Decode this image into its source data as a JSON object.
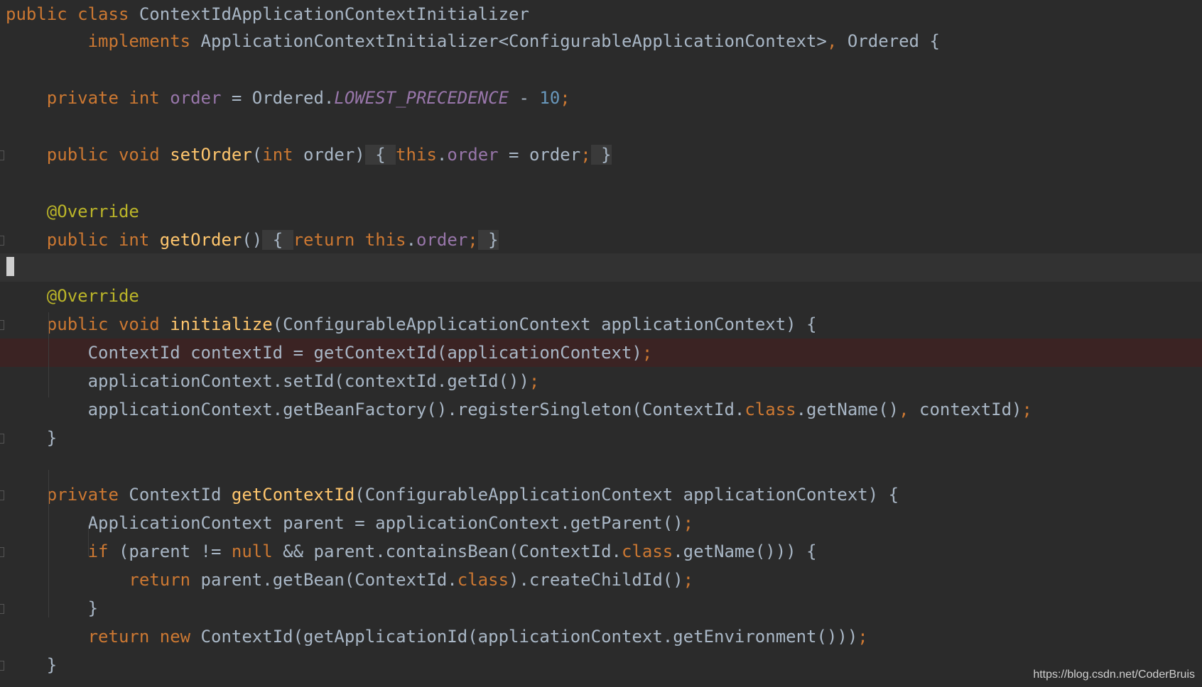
{
  "editor": {
    "theme_colors": {
      "background": "#2b2b2b",
      "keyword": "#cc7832",
      "method_declaration": "#ffc66d",
      "field": "#9876aa",
      "number": "#6897bb",
      "annotation": "#bbb529",
      "plain_text": "#a9b7c6",
      "error_line": "#3b2323",
      "caret_line": "#323232"
    },
    "caret_line": 9,
    "error_line": 12,
    "lines": [
      [
        [
          "kw",
          "public "
        ],
        [
          "kw",
          "class "
        ],
        [
          "plain",
          "ContextIdApplicationContextInitializer"
        ]
      ],
      [
        [
          "plain",
          "        "
        ],
        [
          "kw",
          "implements "
        ],
        [
          "plain",
          "ApplicationContextInitializer<ConfigurableApplicationContext>"
        ],
        [
          "kw",
          ", "
        ],
        [
          "plain",
          "Ordered {"
        ]
      ],
      [],
      [
        [
          "plain",
          "    "
        ],
        [
          "kw",
          "private "
        ],
        [
          "kw",
          "int "
        ],
        [
          "fld",
          "order"
        ],
        [
          "plain",
          " = Ordered."
        ],
        [
          "static",
          "LOWEST_PRECEDENCE"
        ],
        [
          "plain",
          " - "
        ],
        [
          "num",
          "10"
        ],
        [
          "kw",
          ";"
        ]
      ],
      [],
      [
        [
          "plain",
          "    "
        ],
        [
          "kw",
          "public "
        ],
        [
          "kw",
          "void "
        ],
        [
          "fn",
          "setOrder"
        ],
        [
          "plain",
          "("
        ],
        [
          "kw",
          "int "
        ],
        [
          "plain",
          "order)"
        ],
        [
          "fold",
          " { "
        ],
        [
          "kw",
          "this"
        ],
        [
          "plain",
          "."
        ],
        [
          "fld",
          "order"
        ],
        [
          "plain",
          " = order"
        ],
        [
          "kw",
          ";"
        ],
        [
          "fold",
          " }"
        ]
      ],
      [],
      [
        [
          "plain",
          "    "
        ],
        [
          "ann",
          "@Override"
        ]
      ],
      [
        [
          "plain",
          "    "
        ],
        [
          "kw",
          "public "
        ],
        [
          "kw",
          "int "
        ],
        [
          "fn",
          "getOrder"
        ],
        [
          "plain",
          "()"
        ],
        [
          "fold",
          " { "
        ],
        [
          "kw",
          "return "
        ],
        [
          "kw",
          "this"
        ],
        [
          "plain",
          "."
        ],
        [
          "fld",
          "order"
        ],
        [
          "kw",
          ";"
        ],
        [
          "fold",
          " }"
        ]
      ],
      [],
      [
        [
          "plain",
          "    "
        ],
        [
          "ann",
          "@Override"
        ]
      ],
      [
        [
          "plain",
          "    "
        ],
        [
          "kw",
          "public "
        ],
        [
          "kw",
          "void "
        ],
        [
          "fn",
          "initialize"
        ],
        [
          "plain",
          "(ConfigurableApplicationContext applicationContext) {"
        ]
      ],
      [
        [
          "plain",
          "        ContextId contextId = getContextId(applicationContext)"
        ],
        [
          "kw",
          ";"
        ]
      ],
      [
        [
          "plain",
          "        applicationContext.setId(contextId.getId())"
        ],
        [
          "kw",
          ";"
        ]
      ],
      [
        [
          "plain",
          "        applicationContext.getBeanFactory().registerSingleton(ContextId."
        ],
        [
          "kw",
          "class"
        ],
        [
          "plain",
          ".getName()"
        ],
        [
          "kw",
          ", "
        ],
        [
          "plain",
          "contextId)"
        ],
        [
          "kw",
          ";"
        ]
      ],
      [
        [
          "plain",
          "    }"
        ]
      ],
      [],
      [
        [
          "plain",
          "    "
        ],
        [
          "kw",
          "private "
        ],
        [
          "plain",
          "ContextId "
        ],
        [
          "fn",
          "getContextId"
        ],
        [
          "plain",
          "(ConfigurableApplicationContext applicationContext) {"
        ]
      ],
      [
        [
          "plain",
          "        ApplicationContext parent = applicationContext.getParent()"
        ],
        [
          "kw",
          ";"
        ]
      ],
      [
        [
          "plain",
          "        "
        ],
        [
          "kw",
          "if "
        ],
        [
          "plain",
          "(parent != "
        ],
        [
          "kw",
          "null "
        ],
        [
          "plain",
          "&& parent.containsBean(ContextId."
        ],
        [
          "kw",
          "class"
        ],
        [
          "plain",
          ".getName())) {"
        ]
      ],
      [
        [
          "plain",
          "            "
        ],
        [
          "kw",
          "return "
        ],
        [
          "plain",
          "parent.getBean(ContextId."
        ],
        [
          "kw",
          "class"
        ],
        [
          "plain",
          ").createChildId()"
        ],
        [
          "kw",
          ";"
        ]
      ],
      [
        [
          "plain",
          "        }"
        ]
      ],
      [
        [
          "plain",
          "        "
        ],
        [
          "kw",
          "return new "
        ],
        [
          "plain",
          "ContextId(getApplicationId(applicationContext.getEnvironment()))"
        ],
        [
          "kw",
          ";"
        ]
      ],
      [
        [
          "plain",
          "    }"
        ]
      ]
    ]
  },
  "watermark": "https://blog.csdn.net/CoderBruis"
}
